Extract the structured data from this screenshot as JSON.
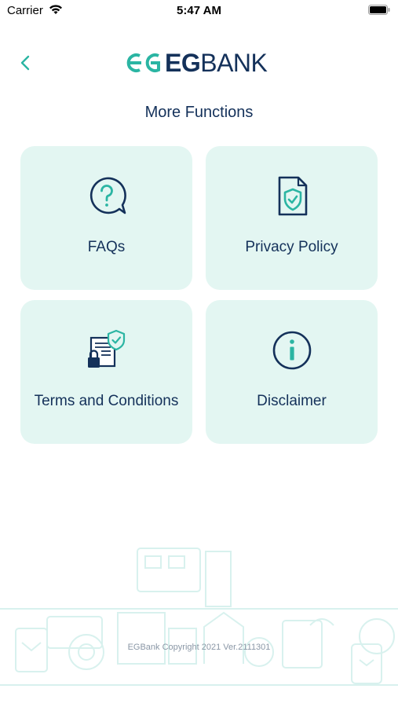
{
  "status_bar": {
    "carrier": "Carrier",
    "time": "5:47 AM"
  },
  "header": {
    "logo_eg": "EG",
    "logo_bank": "BANK"
  },
  "page_title": "More Functions",
  "cards": [
    {
      "label": "FAQs",
      "icon": "question-bubble-icon"
    },
    {
      "label": "Privacy Policy",
      "icon": "shield-document-icon"
    },
    {
      "label": "Terms and Conditions",
      "icon": "document-lock-icon"
    },
    {
      "label": "Disclaimer",
      "icon": "info-icon"
    }
  ],
  "footer": {
    "copyright": "EGBank Copyright 2021 Ver.2111301"
  },
  "colors": {
    "accent": "#2bb5a3",
    "navy": "#14315a",
    "card_bg": "#e3f6f2"
  }
}
